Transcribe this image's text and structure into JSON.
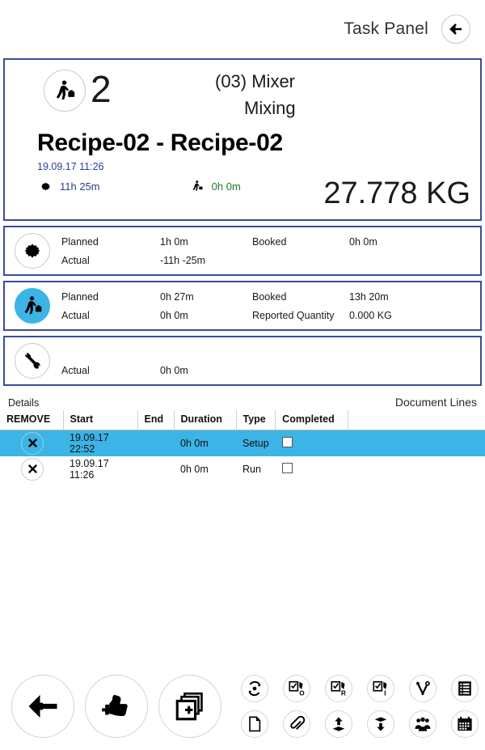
{
  "header": {
    "title": "Task Panel",
    "back_icon": "arrow-left-icon"
  },
  "main_card": {
    "worker_icon": "worker-pushing-icon",
    "task_number": "2",
    "machine_code": "(03) Mixer",
    "machine_name": "Mixing",
    "recipe_title": "Recipe-02 - Recipe-02",
    "date": "19.09.17 11:26",
    "setup_icon": "gear-icon",
    "setup_time": "11h  25m",
    "run_icon": "worker-running-icon",
    "run_time": "0h 0m",
    "quantity": "27.778 KG"
  },
  "stats": [
    {
      "icon": "gear-icon",
      "filled": false,
      "rows": [
        {
          "label1": "Planned",
          "value1": "1h 0m",
          "label2": "Booked",
          "value2": "0h 0m"
        },
        {
          "label1": "Actual",
          "value1": "-11h -25m",
          "label2": "",
          "value2": ""
        }
      ]
    },
    {
      "icon": "worker-running-icon",
      "filled": true,
      "rows": [
        {
          "label1": "Planned",
          "value1": "0h 27m",
          "label2": "Booked",
          "value2": "13h 20m"
        },
        {
          "label1": "Actual",
          "value1": "0h 0m",
          "label2": "Reported Quantity",
          "value2": "0.000 KG"
        }
      ]
    },
    {
      "icon": "tools-icon",
      "filled": false,
      "rows": [
        {
          "label1": "Actual",
          "value1": "0h 0m",
          "label2": "",
          "value2": ""
        }
      ]
    }
  ],
  "tabs": {
    "details": "Details",
    "document_lines": "Document Lines"
  },
  "table": {
    "columns": [
      "REMOVE",
      "Start",
      "End",
      "Duration",
      "Type",
      "Completed"
    ],
    "rows": [
      {
        "remove_icon": "close-x-icon",
        "start": "19.09.17 22:52",
        "end": "",
        "duration": "0h 0m",
        "type": "Setup",
        "completed": false,
        "selected": true
      },
      {
        "remove_icon": "close-x-icon",
        "start": "19.09.17 11:26",
        "end": "",
        "duration": "0h 0m",
        "type": "Run",
        "completed": false,
        "selected": false
      }
    ]
  },
  "toolbar": {
    "big_buttons": [
      {
        "name": "back-button",
        "icon": "arrow-left-icon"
      },
      {
        "name": "confirm-button",
        "icon": "thumbs-up-plus-icon"
      },
      {
        "name": "add-document-button",
        "icon": "stacked-pages-plus-icon"
      }
    ],
    "small_buttons_row1": [
      {
        "name": "refresh-button",
        "icon": "sync-refresh-icon"
      },
      {
        "name": "checklist-o-button",
        "icon": "checklist-o-icon"
      },
      {
        "name": "checklist-r-button",
        "icon": "checklist-r-icon"
      },
      {
        "name": "checklist-i-button",
        "icon": "checklist-i-icon"
      },
      {
        "name": "tool-button",
        "icon": "wrench-v-icon"
      },
      {
        "name": "list-button",
        "icon": "list-lines-icon"
      },
      {
        "name": "manual-button",
        "icon": "book-o-icon"
      }
    ],
    "small_buttons_row2": [
      {
        "name": "document-button",
        "icon": "page-icon"
      },
      {
        "name": "attachment-button",
        "icon": "paperclip-icon"
      },
      {
        "name": "move-up-button",
        "icon": "arrow-up-layer-icon"
      },
      {
        "name": "move-down-button",
        "icon": "arrow-down-layer-icon"
      },
      {
        "name": "team-button",
        "icon": "people-group-icon"
      },
      {
        "name": "calendar-button",
        "icon": "calendar-icon"
      },
      {
        "name": "catalog-button",
        "icon": "open-book-icon"
      }
    ]
  },
  "colors": {
    "card_border": "#3b4a9e",
    "accent_blue": "#3cb4e5",
    "date_blue": "#2b3f8f",
    "run_green": "#1d7a29"
  }
}
